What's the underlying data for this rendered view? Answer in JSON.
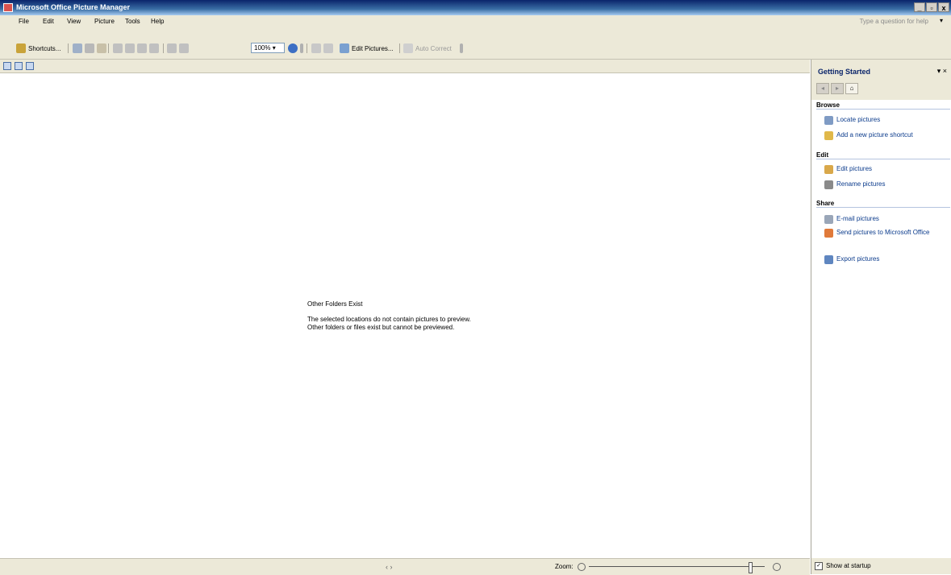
{
  "window": {
    "title": "Microsoft Office Picture Manager",
    "controls": [
      "_",
      "▫",
      "x"
    ]
  },
  "menu": {
    "items": [
      "File",
      "Edit",
      "View",
      "Picture",
      "Tools",
      "Help"
    ],
    "help_placeholder": "Type a question for help"
  },
  "toolbar": {
    "shortcuts_label": "Shortcuts...",
    "zoom_value": "100%",
    "edit_pictures_label": "Edit Pictures...",
    "auto_correct_label": "Auto Correct"
  },
  "main": {
    "message_title": "Other Folders Exist",
    "message_line1": "The selected locations do not contain pictures to preview.",
    "message_line2": "Other folders or files exist but cannot be previewed."
  },
  "status": {
    "nav": "‹ ›",
    "zoom_label": "Zoom:"
  },
  "taskpane": {
    "title": "Getting Started",
    "sections": {
      "browse": {
        "label": "Browse",
        "links": [
          "Locate pictures",
          "Add a new picture shortcut"
        ]
      },
      "edit": {
        "label": "Edit",
        "links": [
          "Edit pictures",
          "Rename pictures"
        ]
      },
      "share": {
        "label": "Share",
        "links": [
          "E-mail pictures",
          "Send pictures to Microsoft Office",
          "Export pictures"
        ]
      }
    },
    "show_at_startup": "Show at startup"
  }
}
